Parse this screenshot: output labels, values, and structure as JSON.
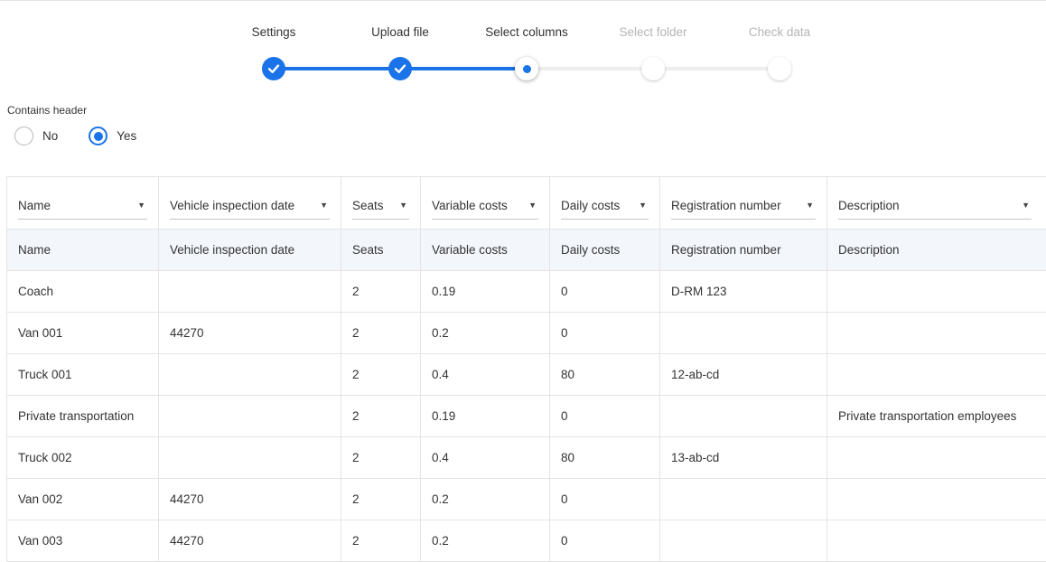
{
  "stepper": {
    "steps": [
      {
        "label": "Settings",
        "state": "done"
      },
      {
        "label": "Upload file",
        "state": "done"
      },
      {
        "label": "Select columns",
        "state": "current"
      },
      {
        "label": "Select folder",
        "state": "todo"
      },
      {
        "label": "Check data",
        "state": "todo"
      }
    ]
  },
  "header_option": {
    "label": "Contains header",
    "options": [
      {
        "label": "No",
        "selected": false
      },
      {
        "label": "Yes",
        "selected": true
      }
    ]
  },
  "table": {
    "column_selects": [
      "Name",
      "Vehicle inspection date",
      "Seats",
      "Variable costs",
      "Daily costs",
      "Registration number",
      "Description"
    ],
    "header_row": [
      "Name",
      "Vehicle inspection date",
      "Seats",
      "Variable costs",
      "Daily costs",
      "Registration number",
      "Description"
    ],
    "rows": [
      [
        "Coach",
        "",
        "2",
        "0.19",
        "0",
        "D-RM 123",
        ""
      ],
      [
        "Van 001",
        "44270",
        "2",
        "0.2",
        "0",
        "",
        ""
      ],
      [
        "Truck 001",
        "",
        "2",
        "0.4",
        "80",
        "12-ab-cd",
        ""
      ],
      [
        "Private transportation",
        "",
        "2",
        "0.19",
        "0",
        "",
        "Private transportation employees"
      ],
      [
        "Truck 002",
        "",
        "2",
        "0.4",
        "80",
        "13-ab-cd",
        ""
      ],
      [
        "Van 002",
        "44270",
        "2",
        "0.2",
        "0",
        "",
        ""
      ],
      [
        "Van 003",
        "44270",
        "2",
        "0.2",
        "0",
        "",
        ""
      ]
    ]
  },
  "colors": {
    "accent": "#1a73e8",
    "inactive_step_text": "#b5b5b5",
    "header_row_bg": "#f3f6fb"
  },
  "icons": {
    "check": "check-icon",
    "dropdown": "caret-down-icon"
  }
}
